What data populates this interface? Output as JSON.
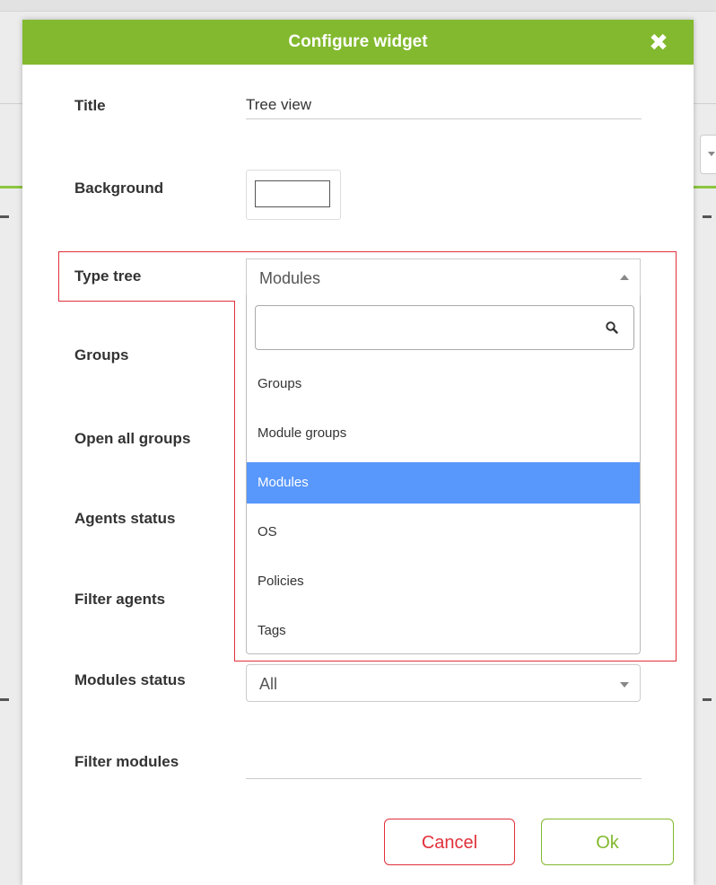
{
  "dialog": {
    "title": "Configure widget",
    "close_glyph": "✖",
    "close_icon": "close-icon"
  },
  "form": {
    "title_label": "Title",
    "title_value": "Tree view",
    "background_label": "Background",
    "background_color": "#ffffff",
    "type_tree_label": "Type tree",
    "type_tree_value": "Modules",
    "groups_label": "Groups",
    "open_all_groups_label": "Open all groups",
    "agents_status_label": "Agents status",
    "filter_agents_label": "Filter agents",
    "modules_status_label": "Modules status",
    "modules_status_value": "All",
    "filter_modules_label": "Filter modules",
    "filter_modules_value": ""
  },
  "dropdown": {
    "search_placeholder": "",
    "search_icon": "search-icon",
    "options": [
      "Groups",
      "Module groups",
      "Modules",
      "OS",
      "Policies",
      "Tags"
    ],
    "selected": "Modules"
  },
  "buttons": {
    "cancel": "Cancel",
    "ok": "Ok"
  },
  "colors": {
    "header_green": "#82b92e",
    "highlight_red": "#e0303a",
    "selected_blue": "#5897fb"
  }
}
